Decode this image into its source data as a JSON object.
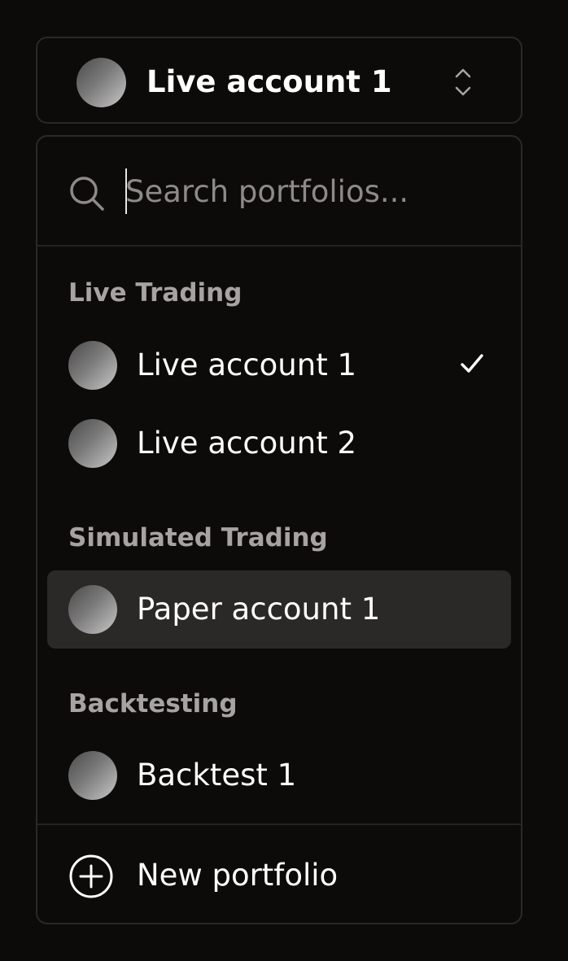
{
  "selector": {
    "current_label": "Live account 1",
    "avatar_icon": "avatar-icon",
    "chevron_icon": "chevron-up-down-icon"
  },
  "search": {
    "placeholder": "Search portfolios...",
    "value": "",
    "icon": "search-icon"
  },
  "groups": [
    {
      "heading": "Live Trading",
      "items": [
        {
          "label": "Live account 1",
          "selected": true,
          "highlighted": false
        },
        {
          "label": "Live account 2",
          "selected": false,
          "highlighted": false
        }
      ]
    },
    {
      "heading": "Simulated Trading",
      "items": [
        {
          "label": "Paper account 1",
          "selected": false,
          "highlighted": true
        }
      ]
    },
    {
      "heading": "Backtesting",
      "items": [
        {
          "label": "Backtest 1",
          "selected": false,
          "highlighted": false
        }
      ]
    }
  ],
  "footer": {
    "new_label": "New portfolio",
    "icon": "plus-circle-icon"
  },
  "colors": {
    "background": "#0c0b0a",
    "border": "#2a2828",
    "highlight": "#2b2828",
    "muted_text": "#a6a3a1",
    "placeholder": "#8d8a88",
    "text": "#ffffff"
  }
}
